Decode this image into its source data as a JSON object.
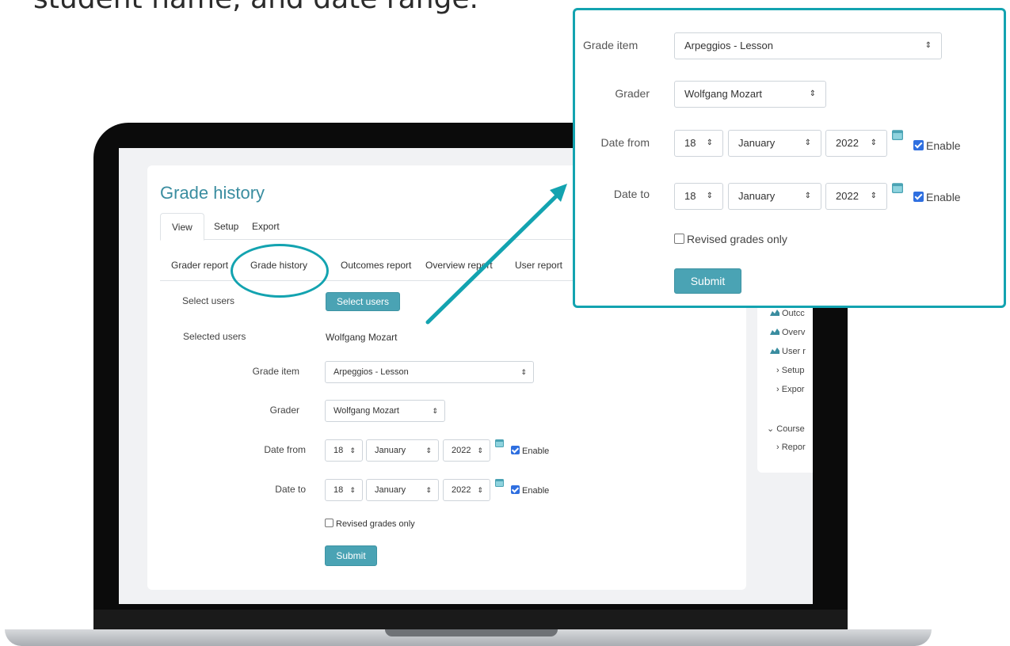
{
  "headline": "student name, and date range.",
  "accent_color": "#13a3b0",
  "page": {
    "title": "Grade history",
    "top_tabs": [
      "View",
      "Setup",
      "Export"
    ],
    "sub_tabs": [
      "Grader report",
      "Grade history",
      "Outcomes report",
      "Overview report",
      "User report"
    ]
  },
  "form": {
    "select_users_label": "Select users",
    "select_users_button": "Select users",
    "selected_users_label": "Selected users",
    "selected_users_value": "Wolfgang Mozart",
    "grade_item_label": "Grade item",
    "grade_item_value": "Arpeggios - Lesson",
    "grader_label": "Grader",
    "grader_value": "Wolfgang Mozart",
    "date_from_label": "Date from",
    "date_to_label": "Date to",
    "day": "18",
    "month": "January",
    "year": "2022",
    "enable_label": "Enable",
    "revised_label": "Revised grades only",
    "submit_label": "Submit"
  },
  "sidebar": {
    "items": [
      "Outcc",
      "Overv",
      "User r",
      "Setup",
      "Expor",
      "Course",
      "Repor"
    ]
  },
  "icons": {
    "select_arrow": "⇕",
    "calendar": "calendar-icon",
    "report": "chart-icon",
    "expand": "chevron-right-icon",
    "collapse": "chevron-down-icon"
  }
}
